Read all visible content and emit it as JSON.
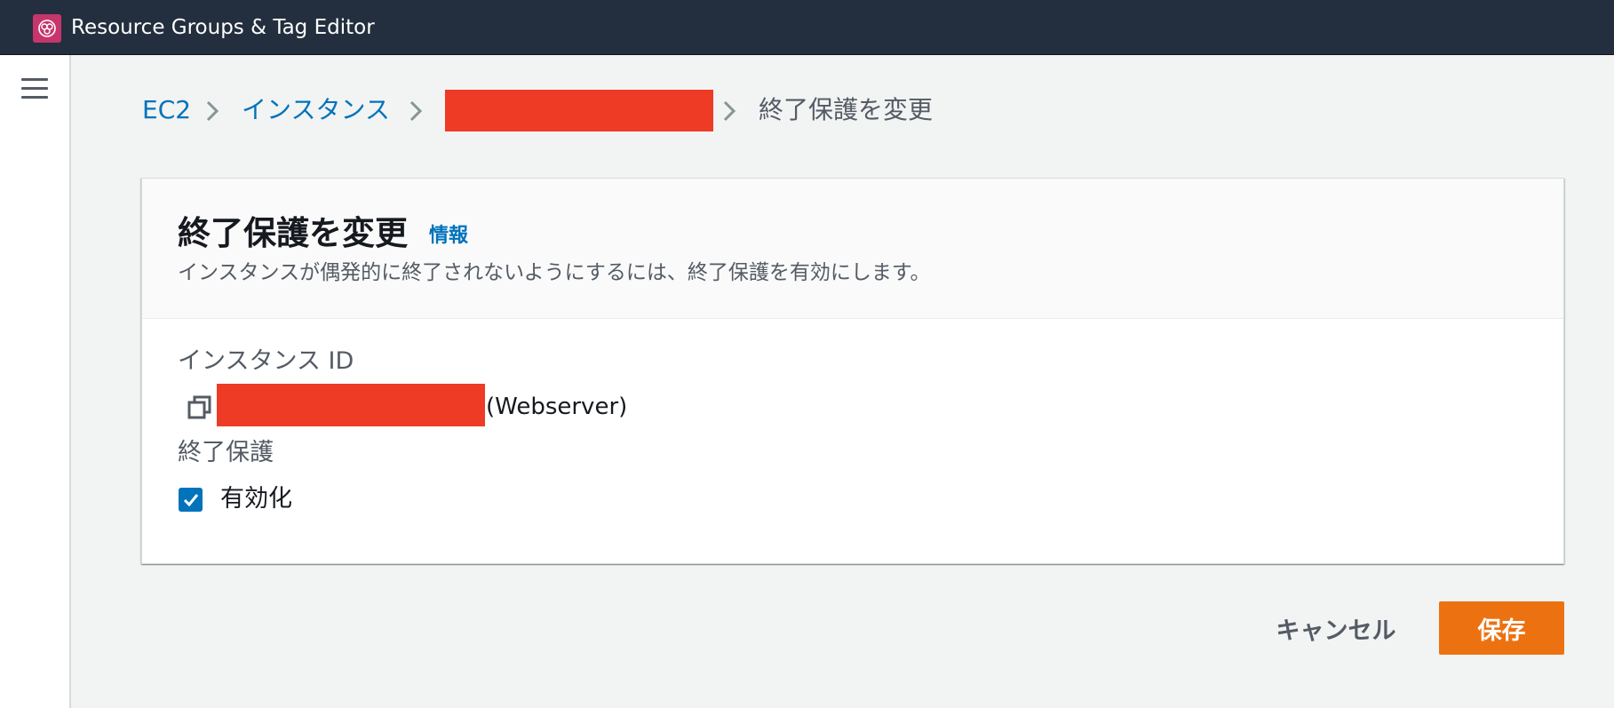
{
  "header": {
    "app_title": "Resource Groups & Tag Editor",
    "logo_icon": "resource-groups-icon",
    "logo_color": "#c7356d",
    "background_color": "#232f3e"
  },
  "sidebar": {
    "menu_icon": "hamburger-menu-icon"
  },
  "breadcrumb": {
    "items": [
      {
        "label": "EC2",
        "type": "link"
      },
      {
        "label": "インスタンス",
        "type": "link"
      },
      {
        "label": "",
        "type": "redacted"
      }
    ],
    "current": "終了保護を変更",
    "separator_icon": "chevron-right-icon"
  },
  "card": {
    "title": "終了保護を変更",
    "info_link": "情報",
    "description": "インスタンスが偶発的に終了されないようにするには、終了保護を有効にします。",
    "instance_id_label": "インスタンス ID",
    "instance_id_value_suffix": "(Webserver)",
    "copy_icon": "copy-icon",
    "termination_protection_label": "終了保護",
    "enable_checkbox": {
      "label": "有効化",
      "checked": true
    }
  },
  "actions": {
    "cancel_label": "キャンセル",
    "save_label": "保存"
  },
  "colors": {
    "link": "#0073bb",
    "primary_button": "#ec7211",
    "redaction": "#ee3b26",
    "page_background": "#f2f3f3"
  }
}
